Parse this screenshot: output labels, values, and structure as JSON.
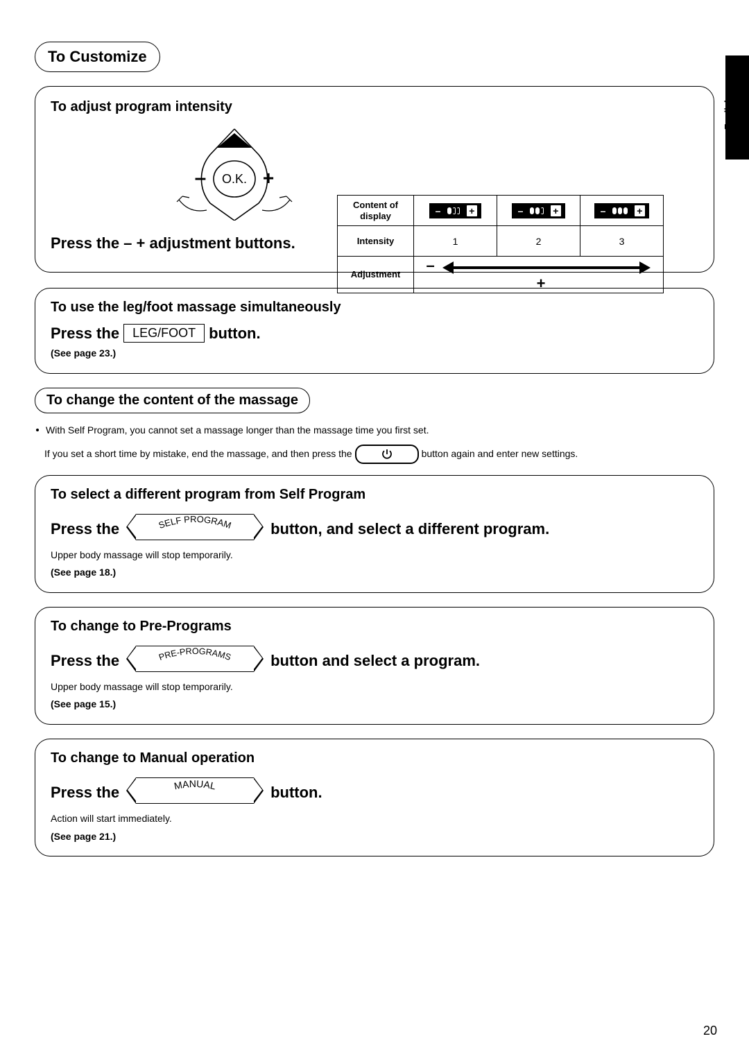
{
  "sideTab": {
    "label": "English"
  },
  "title": "To Customize",
  "adjust": {
    "heading": "To adjust program intensity",
    "remote": {
      "ok": "O.K."
    },
    "instruction": "Press the – + adjustment buttons.",
    "table": {
      "rowLabels": {
        "content": "Content of display",
        "intensity": "Intensity",
        "adjustment": "Adjustment"
      },
      "intensityValues": [
        "1",
        "2",
        "3"
      ],
      "adjMinus": "–",
      "adjPlus": "+"
    }
  },
  "legFoot": {
    "heading": "To use the leg/foot massage simultaneously",
    "pressThe": "Press the",
    "btnLabel": "LEG/FOOT",
    "buttonWord": "button.",
    "note": "(See page 23.)"
  },
  "changeContent": {
    "heading": "To change the content of the massage",
    "bullet": "With Self Program, you cannot set a massage longer than the massage time you first set.",
    "line2a": "If you set a short time by mistake, end the massage, and then press the",
    "line2b": "button again and enter new settings."
  },
  "selfProgram": {
    "heading": "To select a different program from Self Program",
    "pressThe": "Press the",
    "btnLabel": "SELF PROGRAM",
    "afterBtn": "button, and select a different program.",
    "note1": "Upper body massage will stop temporarily.",
    "note2": "(See page 18.)"
  },
  "prePrograms": {
    "heading": "To change to Pre-Programs",
    "pressThe": "Press the",
    "btnLabel": "PRE-PROGRAMS",
    "afterBtn": "button and select a program.",
    "note1": "Upper body massage will stop temporarily.",
    "note2": "(See page 15.)"
  },
  "manual": {
    "heading": "To change to Manual operation",
    "pressThe": "Press the",
    "btnLabel": "MANUAL",
    "buttonWord": "button.",
    "note1": "Action will start immediately.",
    "note2": "(See page 21.)"
  },
  "pageNumber": "20"
}
